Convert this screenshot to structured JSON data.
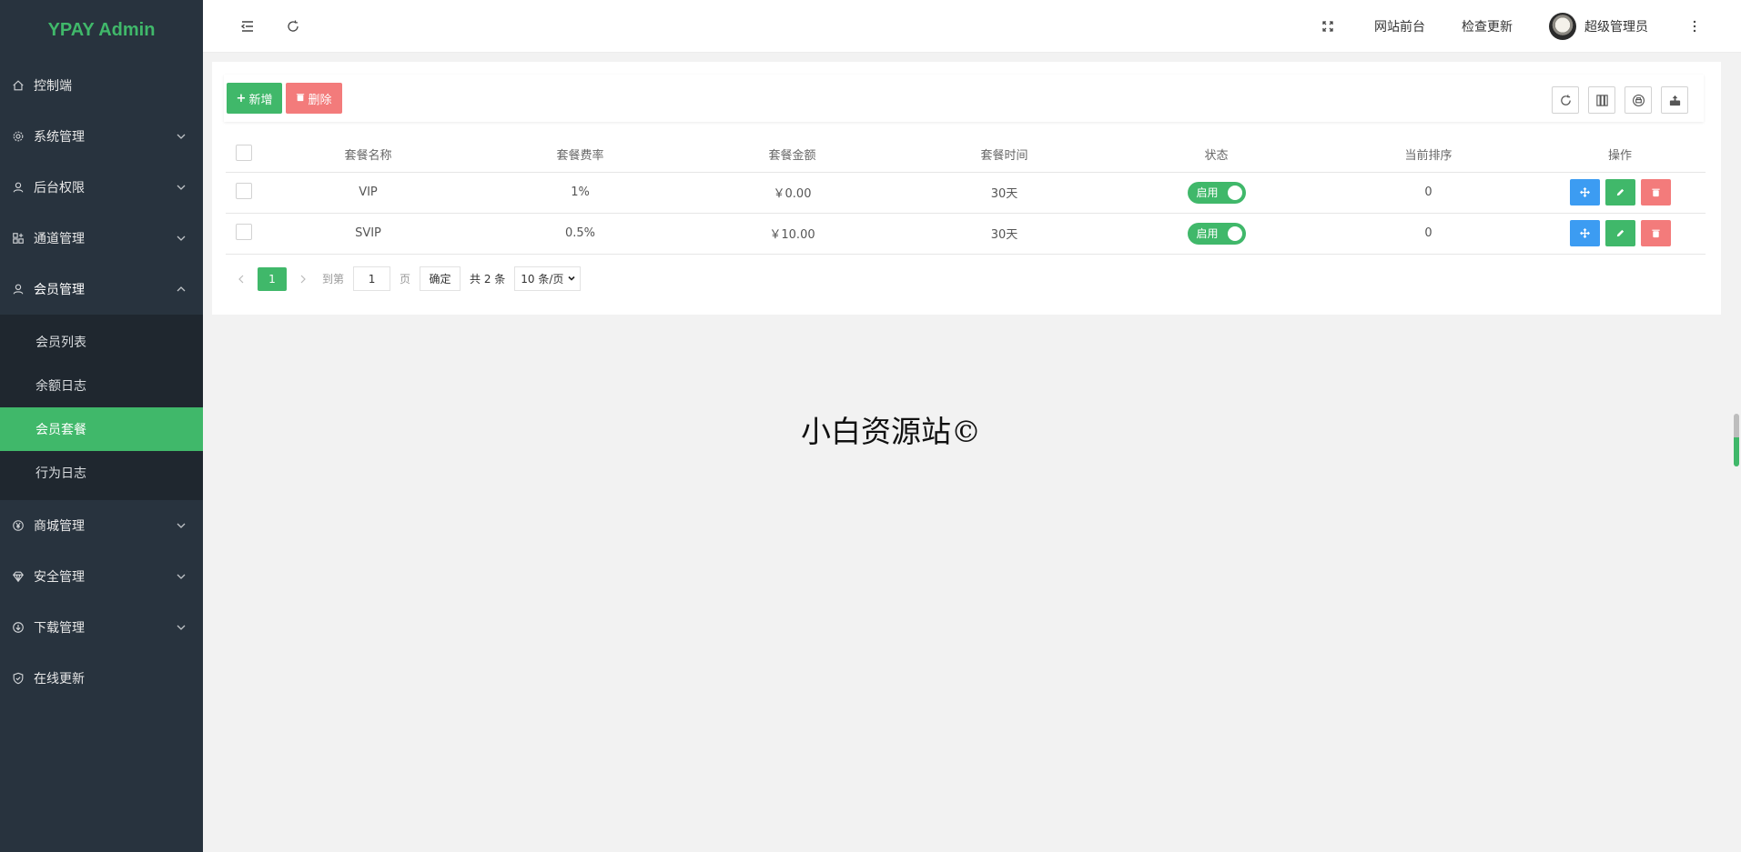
{
  "sidebar": {
    "logo": "YPAY Admin",
    "items": [
      {
        "label": "控制端",
        "icon": "home-icon"
      },
      {
        "label": "系统管理",
        "icon": "gear-icon"
      },
      {
        "label": "后台权限",
        "icon": "user-icon"
      },
      {
        "label": "通道管理",
        "icon": "apps-icon"
      },
      {
        "label": "会员管理",
        "icon": "user-icon"
      },
      {
        "label": "商城管理",
        "icon": "yen-icon"
      },
      {
        "label": "安全管理",
        "icon": "diamond-icon"
      },
      {
        "label": "下载管理",
        "icon": "download-icon"
      },
      {
        "label": "在线更新",
        "icon": "shield-check-icon"
      }
    ],
    "submenu": [
      {
        "label": "会员列表"
      },
      {
        "label": "余额日志"
      },
      {
        "label": "会员套餐",
        "active": true
      },
      {
        "label": "行为日志"
      }
    ]
  },
  "header": {
    "site_front": "网站前台",
    "check_update": "检查更新",
    "username": "超级管理员"
  },
  "toolbar": {
    "add_label": "新增",
    "delete_label": "删除"
  },
  "table": {
    "columns": [
      "套餐名称",
      "套餐费率",
      "套餐金额",
      "套餐时间",
      "状态",
      "当前排序",
      "操作"
    ],
    "rows": [
      {
        "name": "VIP",
        "rate": "1%",
        "amount": "￥0.00",
        "time": "30天",
        "status": "启用",
        "sort": "0"
      },
      {
        "name": "SVIP",
        "rate": "0.5%",
        "amount": "￥10.00",
        "time": "30天",
        "status": "启用",
        "sort": "0"
      }
    ]
  },
  "pager": {
    "current_page": "1",
    "goto_label": "到第",
    "goto_value": "1",
    "page_suffix": "页",
    "confirm": "确定",
    "total": "共 2 条",
    "page_size": "10 条/页"
  },
  "watermark": "小白资源站©",
  "colors": {
    "accent": "#40b86a",
    "danger": "#f37b7b",
    "info": "#3c9cf2",
    "sidebar_bg": "#28333e"
  }
}
